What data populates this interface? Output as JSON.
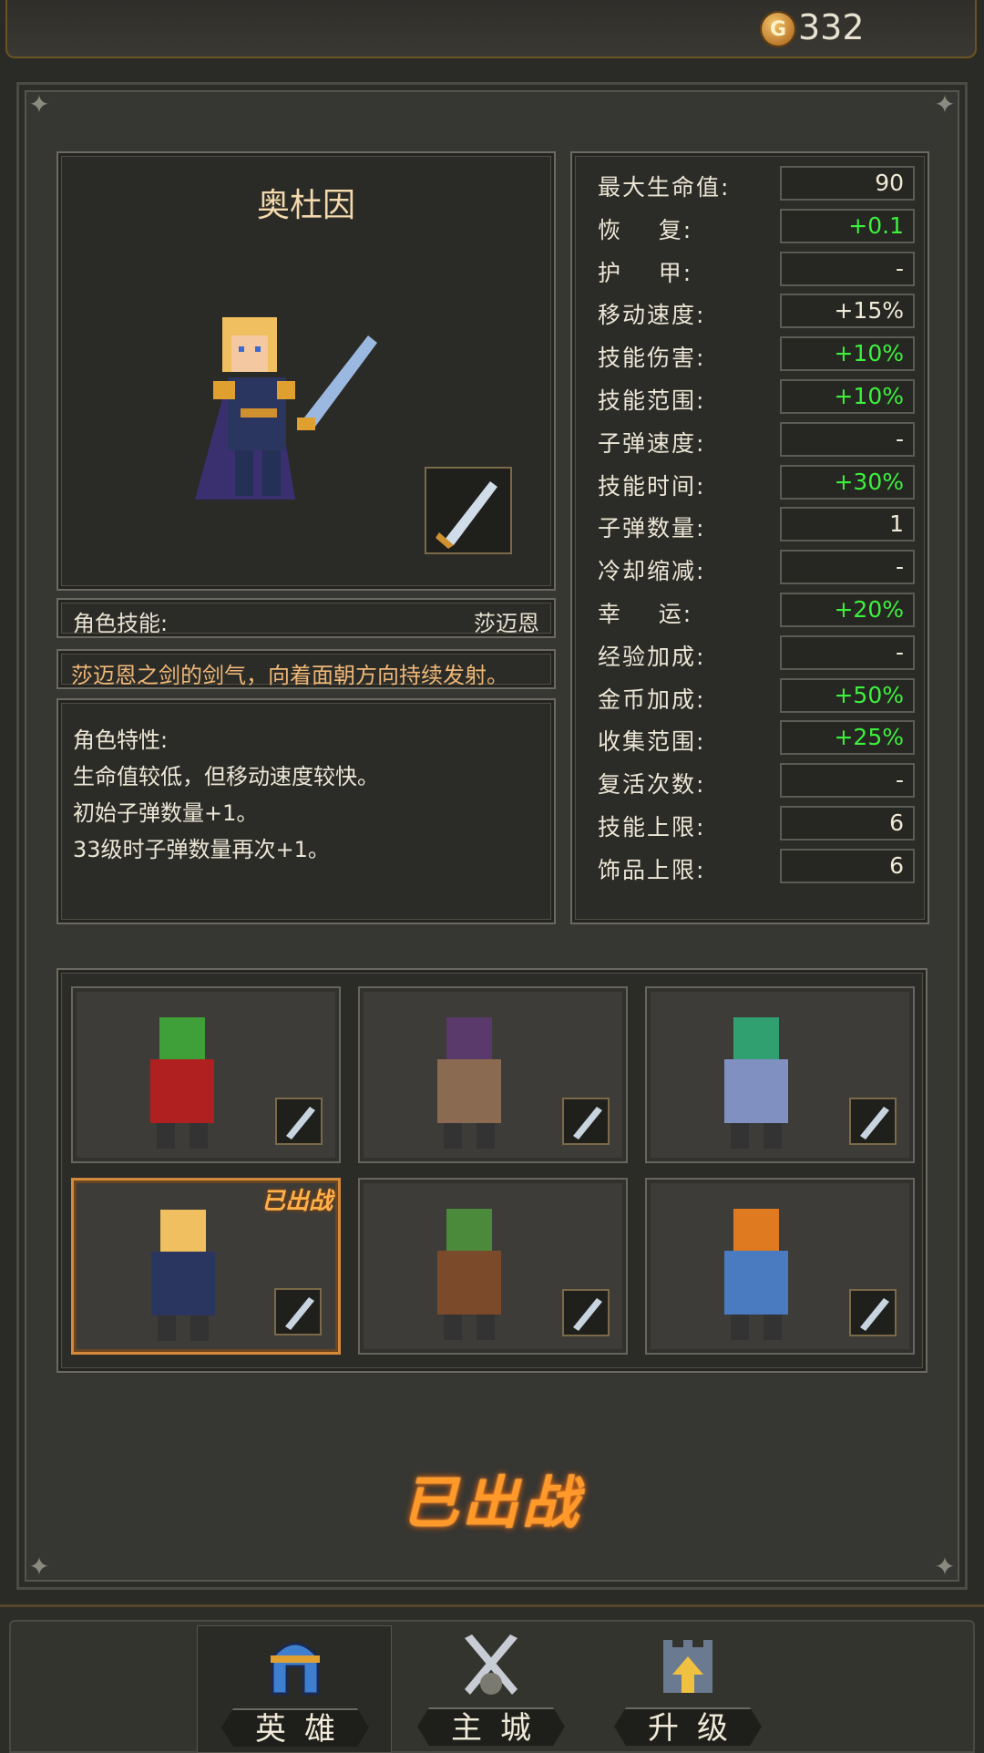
{
  "currency": {
    "icon": "gold-coin-icon",
    "symbol": "G",
    "amount": "332"
  },
  "hero": {
    "name": "奥杜因",
    "skill_label": "角色技能:",
    "skill_name": "莎迈恩",
    "skill_desc": "莎迈恩之剑的剑气，向着面朝方向持续发射。",
    "traits": [
      "角色特性:",
      "生命值较低，但移动速度较快。",
      "初始子弹数量+1。",
      "33级时子弹数量再次+1。"
    ]
  },
  "stats": [
    {
      "label": "最大生命值:",
      "value": "90",
      "color": "#f0ead8"
    },
    {
      "label": "恢    复:",
      "value": "+0.1",
      "color": "#3cf03c"
    },
    {
      "label": "护    甲:",
      "value": "-",
      "color": "#f0ead8"
    },
    {
      "label": "移动速度:",
      "value": "+15%",
      "color": "#f0ead8"
    },
    {
      "label": "技能伤害:",
      "value": "+10%",
      "color": "#3cf03c"
    },
    {
      "label": "技能范围:",
      "value": "+10%",
      "color": "#3cf03c"
    },
    {
      "label": "子弹速度:",
      "value": "-",
      "color": "#f0ead8"
    },
    {
      "label": "技能时间:",
      "value": "+30%",
      "color": "#3cf03c"
    },
    {
      "label": "子弹数量:",
      "value": "1",
      "color": "#f0ead8"
    },
    {
      "label": "冷却缩减:",
      "value": "-",
      "color": "#f0ead8"
    },
    {
      "label": "幸    运:",
      "value": "+20%",
      "color": "#3cf03c"
    },
    {
      "label": "经验加成:",
      "value": "-",
      "color": "#f0ead8"
    },
    {
      "label": "金币加成:",
      "value": "+50%",
      "color": "#3cf03c"
    },
    {
      "label": "收集范围:",
      "value": "+25%",
      "color": "#3cf03c"
    },
    {
      "label": "复活次数:",
      "value": "-",
      "color": "#f0ead8"
    },
    {
      "label": "技能上限:",
      "value": "6",
      "color": "#f0ead8"
    },
    {
      "label": "饰品上限:",
      "value": "6",
      "color": "#f0ead8"
    }
  ],
  "roster": [
    {
      "hero": "goblin-hero-icon",
      "weapon": "scimitar-icon",
      "selected": false,
      "tag": ""
    },
    {
      "hero": "hooded-mage-hero-icon",
      "weapon": "staff-icon",
      "selected": false,
      "tag": ""
    },
    {
      "hero": "elf-archer-hero-icon",
      "weapon": "purple-gem-icon",
      "selected": false,
      "tag": ""
    },
    {
      "hero": "blonde-swordsman-hero-icon",
      "weapon": "sword-icon",
      "selected": true,
      "tag": "已出战"
    },
    {
      "hero": "orc-warrior-hero-icon",
      "weapon": "hammer-icon",
      "selected": false,
      "tag": ""
    },
    {
      "hero": "dwarf-hero-icon",
      "weapon": "axe-icon",
      "selected": false,
      "tag": ""
    }
  ],
  "deploy_status": "已出战",
  "nav": [
    {
      "label": "英雄",
      "icon": "helmet-icon",
      "active": true
    },
    {
      "label": "主城",
      "icon": "crossed-swords-icon",
      "active": false
    },
    {
      "label": "升级",
      "icon": "castle-upgrade-icon",
      "active": false
    }
  ]
}
